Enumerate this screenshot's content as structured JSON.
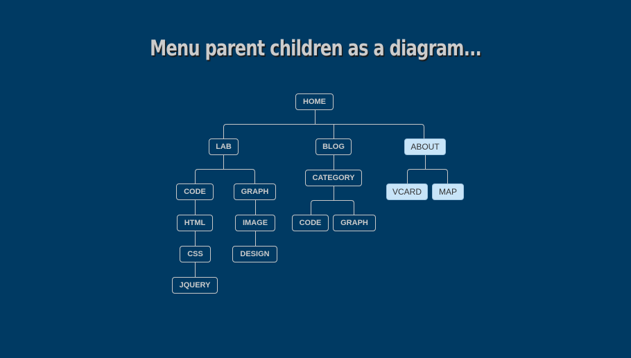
{
  "page": {
    "title": "Menu parent children as a diagram..."
  },
  "colors": {
    "background": "#003a63",
    "node_border": "#c8c8c8",
    "node_text": "#cccccc",
    "active_fill": "#c8e4f8",
    "active_text": "#333333"
  },
  "tree": {
    "home": {
      "label": "HOME",
      "active": false
    },
    "lab": {
      "label": "LAB",
      "active": false
    },
    "lab_code": {
      "label": "CODE",
      "active": false
    },
    "lab_html": {
      "label": "HTML",
      "active": false
    },
    "lab_css": {
      "label": "CSS",
      "active": false
    },
    "lab_jquery": {
      "label": "JQUERY",
      "active": false
    },
    "lab_graph": {
      "label": "GRAPH",
      "active": false
    },
    "lab_image": {
      "label": "IMAGE",
      "active": false
    },
    "lab_design": {
      "label": "DESIGN",
      "active": false
    },
    "blog": {
      "label": "BLOG",
      "active": false
    },
    "blog_category": {
      "label": "CATEGORY",
      "active": false
    },
    "blog_code": {
      "label": "CODE",
      "active": false
    },
    "blog_graph": {
      "label": "GRAPH",
      "active": false
    },
    "about": {
      "label": "ABOUT",
      "active": true
    },
    "about_vcard": {
      "label": "VCARD",
      "active": true
    },
    "about_map": {
      "label": "MAP",
      "active": true
    }
  },
  "hierarchy": [
    {
      "id": "home",
      "children": [
        {
          "id": "lab",
          "children": [
            {
              "id": "lab_code",
              "children": [
                {
                  "id": "lab_html",
                  "children": [
                    {
                      "id": "lab_css",
                      "children": [
                        {
                          "id": "lab_jquery"
                        }
                      ]
                    }
                  ]
                }
              ]
            },
            {
              "id": "lab_graph",
              "children": [
                {
                  "id": "lab_image",
                  "children": [
                    {
                      "id": "lab_design"
                    }
                  ]
                }
              ]
            }
          ]
        },
        {
          "id": "blog",
          "children": [
            {
              "id": "blog_category",
              "children": [
                {
                  "id": "blog_code"
                },
                {
                  "id": "blog_graph"
                }
              ]
            }
          ]
        },
        {
          "id": "about",
          "children": [
            {
              "id": "about_vcard"
            },
            {
              "id": "about_map"
            }
          ]
        }
      ]
    }
  ]
}
